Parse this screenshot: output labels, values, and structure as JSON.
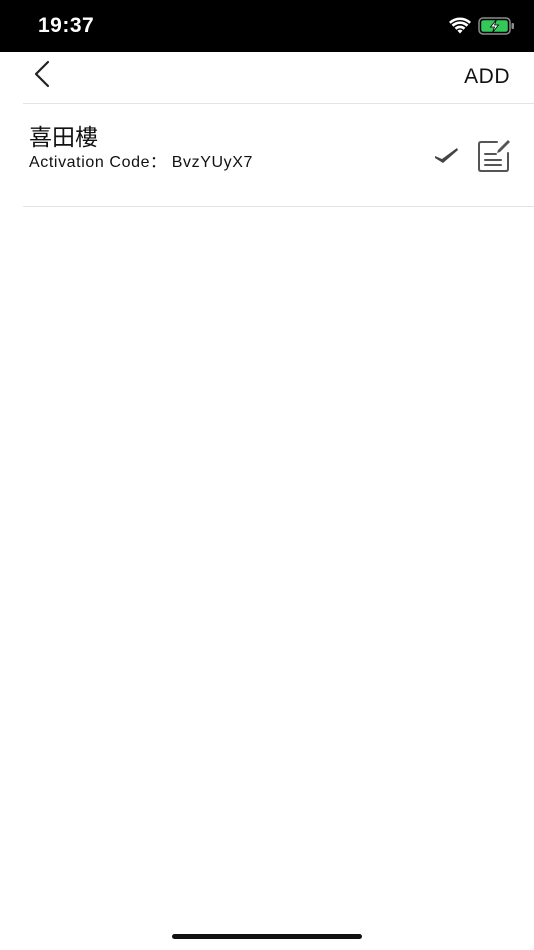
{
  "status_bar": {
    "time": "19:37",
    "icons": [
      "wifi-icon",
      "battery-charging-icon"
    ],
    "battery_color": "#34c759"
  },
  "nav": {
    "back_icon": "chevron-left-icon",
    "add_label": "ADD"
  },
  "list": {
    "items": [
      {
        "name": "喜田樓",
        "code_label": "Activation Code：",
        "code_value": "BvzYUyX7",
        "actions": [
          "check-icon",
          "edit-icon"
        ]
      }
    ]
  },
  "colors": {
    "divider": "#e4e4e4",
    "icon": "#444444"
  }
}
